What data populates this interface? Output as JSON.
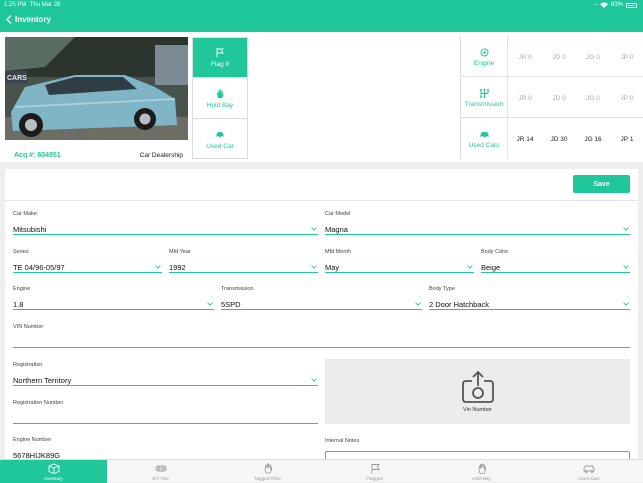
{
  "status_bar": {
    "time": "1:25 PM",
    "date": "Thu Mar 28",
    "battery": "83%"
  },
  "nav": {
    "back_label": "Inventory"
  },
  "vehicle": {
    "acq": "Acq #: 604951",
    "source": "Car Dealership",
    "photo_sign": "CARS"
  },
  "actions": [
    {
      "label": "Flag It",
      "icon": "flag-icon",
      "active": true
    },
    {
      "label": "Hold Bay",
      "icon": "hand-icon",
      "active": false
    },
    {
      "label": "Used Car",
      "icon": "car-icon",
      "active": false
    }
  ],
  "grid": [
    {
      "label": "Engine",
      "icon": "engine-icon",
      "values": [
        "JR 0",
        "JD 0",
        "JG 0",
        "JP 0"
      ]
    },
    {
      "label": "Transmission",
      "icon": "transmission-icon",
      "values": [
        "JR 0",
        "JD 0",
        "JG 0",
        "JP 0"
      ]
    },
    {
      "label": "Used Cars",
      "icon": "car-icon",
      "values": [
        "JR 14",
        "JD 30",
        "JG 16",
        "JP 1"
      ]
    }
  ],
  "form": {
    "save_label": "Save",
    "car_make": {
      "label": "Car Make",
      "value": "Mitsubishi"
    },
    "car_model": {
      "label": "Car Model",
      "value": "Magna"
    },
    "series": {
      "label": "Series",
      "value": "TE 04/96-05/97"
    },
    "mfd_year": {
      "label": "Mfd Year",
      "value": "1992"
    },
    "mfd_month": {
      "label": "Mfd Month",
      "value": "May"
    },
    "body_color": {
      "label": "Body Color",
      "value": "Beige"
    },
    "engine": {
      "label": "Engine",
      "value": "1.8"
    },
    "transmission": {
      "label": "Transmission",
      "value": "5SPD"
    },
    "body_type": {
      "label": "Body Type",
      "value": "2 Door Hatchback"
    },
    "vin": {
      "label": "VIN Number",
      "value": ""
    },
    "registration": {
      "label": "Registration",
      "value": "Northern Territory"
    },
    "registration_number": {
      "label": "Registration Number",
      "value": ""
    },
    "engine_number": {
      "label": "Engine Number",
      "value": "5678HIJK89G"
    },
    "vin_upload_label": "Vin Number",
    "internal_notes_label": "Internal Notes"
  },
  "tabs": [
    {
      "label": "Inventory",
      "icon": "box-icon",
      "active": true
    },
    {
      "label": "E/T Text",
      "icon": "engine-icon",
      "active": false
    },
    {
      "label": "Tagged Parts",
      "icon": "tag-icon",
      "active": false
    },
    {
      "label": "Flagged",
      "icon": "flag-icon",
      "active": false
    },
    {
      "label": "Hold Bay",
      "icon": "hand-icon",
      "active": false
    },
    {
      "label": "Used Cars",
      "icon": "car-icon",
      "active": false
    }
  ],
  "colors": {
    "accent": "#1fc79a",
    "background": "#eeeeee",
    "muted": "#aaaaaa"
  }
}
